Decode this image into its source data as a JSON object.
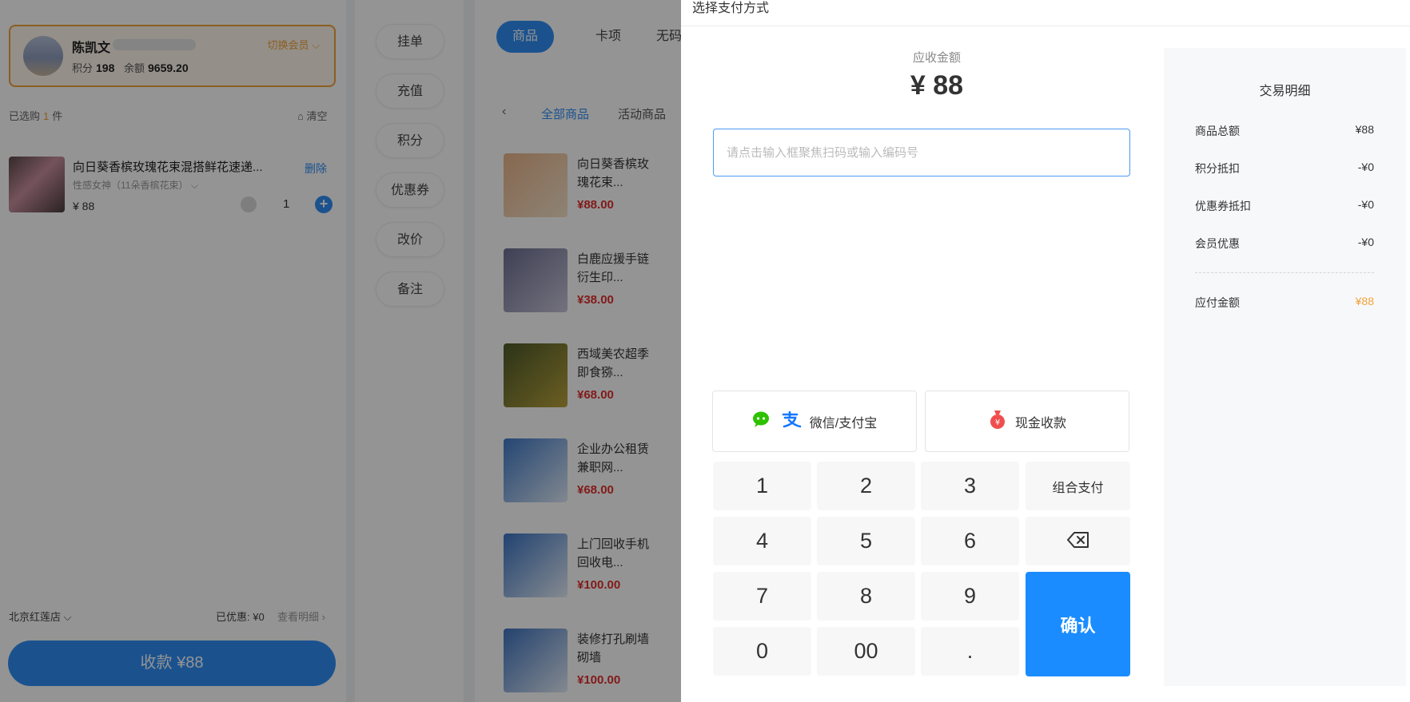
{
  "background": {
    "member": {
      "name": "陈凯文",
      "switch_label": "切换会员",
      "points_label": "积分",
      "points": "198",
      "balance_label": "余额",
      "balance": "9659.20"
    },
    "cart": {
      "selected_prefix": "已选购",
      "selected_count": "1",
      "selected_suffix": "件",
      "clear_label": "清空",
      "item": {
        "title": "向日葵香槟玫瑰花束混搭鲜花速递...",
        "spec": "性感女神（11朵香槟花束）",
        "price": "¥ 88",
        "delete_label": "删除",
        "quantity": "1"
      }
    },
    "footer": {
      "store": "北京红莲店",
      "discount": "已优惠: ¥0",
      "detail_link": "查看明细",
      "checkout_label": "收款 ¥88"
    },
    "side_actions": [
      "挂单",
      "充值",
      "积分",
      "优惠券",
      "改价",
      "备注"
    ],
    "top_tabs": [
      "商品",
      "卡项",
      "无码商品"
    ],
    "categories": [
      "全部商品",
      "活动商品"
    ],
    "products": [
      {
        "name": "向日葵香槟玫瑰花束...",
        "price": "¥88.00",
        "color1": "#e9b48a",
        "color2": "#f4e2c9"
      },
      {
        "name": "白鹿应援手链衍生印...",
        "price": "¥38.00",
        "color1": "#6c6f92",
        "color2": "#c8c4d8"
      },
      {
        "name": "西域美农超季即食猕...",
        "price": "¥68.00",
        "color1": "#4d5a2a",
        "color2": "#b9a23c"
      },
      {
        "name": "企业办公租赁兼职网...",
        "price": "¥68.00",
        "color1": "#3f79c7",
        "color2": "#dfeaf7"
      },
      {
        "name": "上门回收手机回收电...",
        "price": "¥100.00",
        "color1": "#3a74c4",
        "color2": "#e6eef8"
      },
      {
        "name": "装修打孔刷墙砌墙",
        "price": "¥100.00",
        "color1": "#3e73bf",
        "color2": "#e3ecf7"
      }
    ]
  },
  "drawer": {
    "title": "选择支付方式",
    "amount_label": "应收金额",
    "amount_value": "¥ 88",
    "scan_placeholder": "请点击输入框聚焦扫码或输入编码号",
    "methods": {
      "wechat_alipay": "微信/支付宝",
      "cash": "现金收款"
    },
    "keypad": {
      "k1": "1",
      "k2": "2",
      "k3": "3",
      "k4": "4",
      "k5": "5",
      "k6": "6",
      "k7": "7",
      "k8": "8",
      "k9": "9",
      "k0": "0",
      "k00": "00",
      "kdot": ".",
      "combo": "组合支付",
      "confirm": "确认"
    },
    "details": {
      "title": "交易明细",
      "rows": [
        {
          "label": "商品总额",
          "value": "¥88"
        },
        {
          "label": "积分抵扣",
          "value": "-¥0"
        },
        {
          "label": "优惠券抵扣",
          "value": "-¥0"
        },
        {
          "label": "会员优惠",
          "value": "-¥0"
        }
      ],
      "total": {
        "label": "应付金额",
        "value": "¥88"
      }
    },
    "colors": {
      "primary": "#1a8cff",
      "accent": "#f0a33a",
      "wechat": "#2dc100",
      "alipay": "#1677ff",
      "cash": "#f04e4e"
    }
  }
}
